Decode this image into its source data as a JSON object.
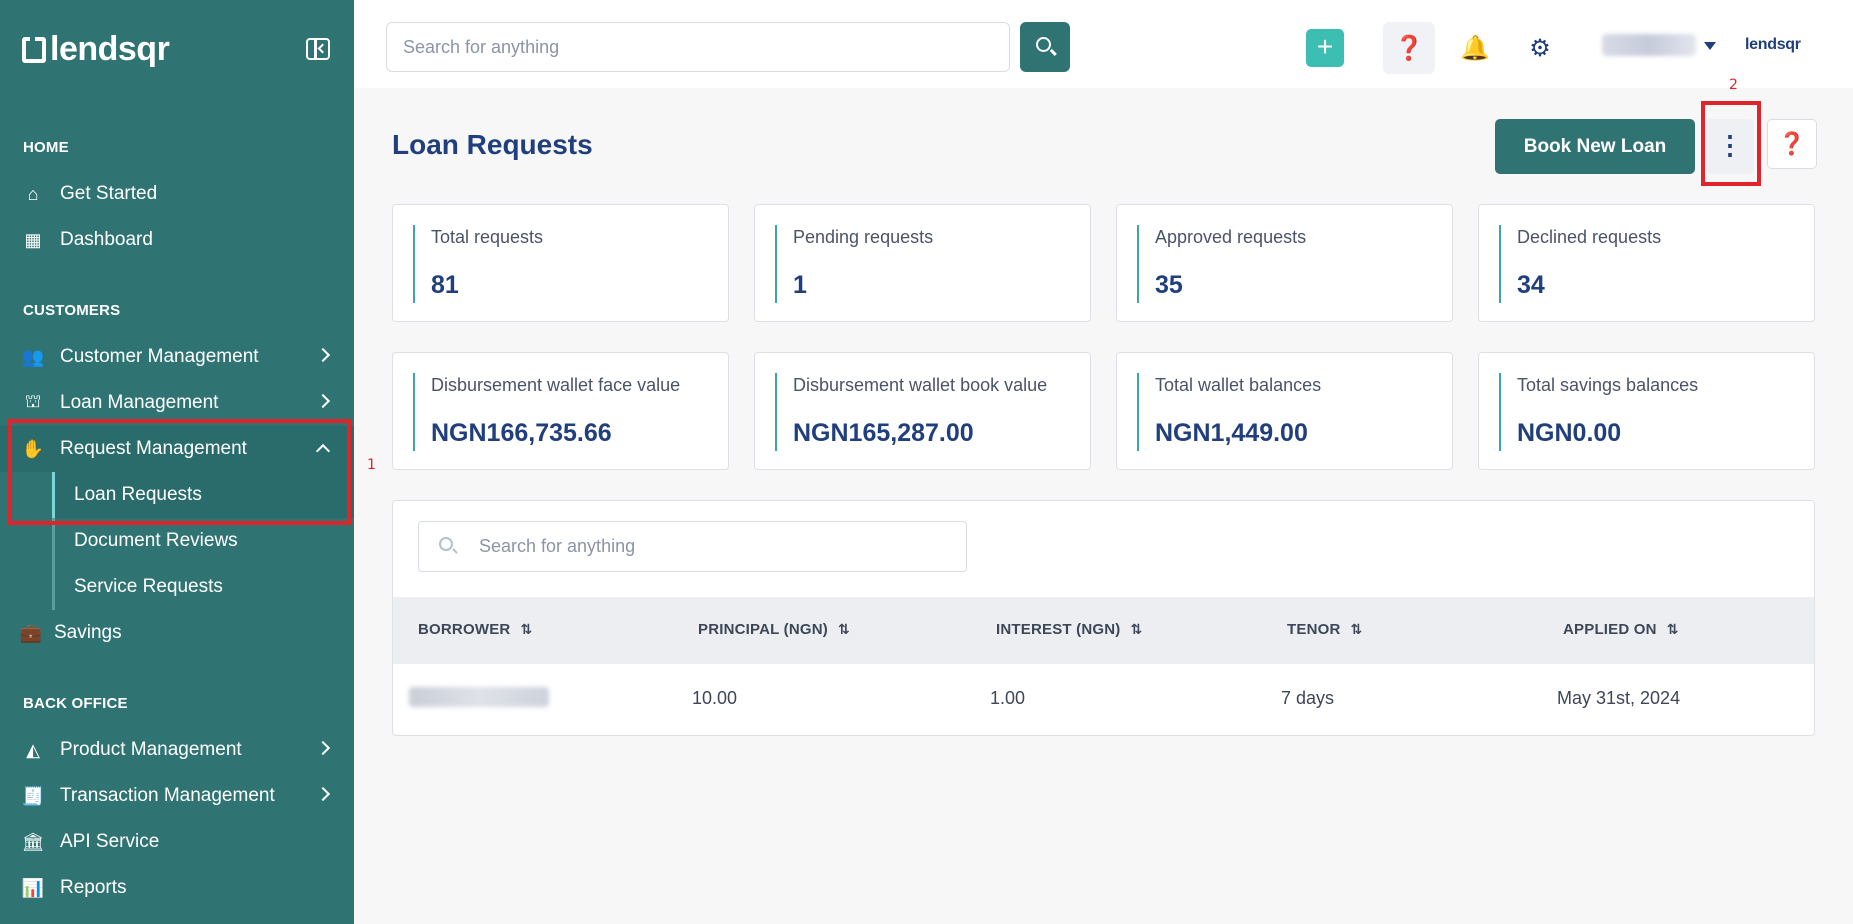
{
  "brand": {
    "logo_text": "lendsqr",
    "small_logo_text": "lendsqr"
  },
  "topbar": {
    "search_placeholder": "Search for anything"
  },
  "sidebar": {
    "sections": {
      "home": "HOME",
      "customers": "CUSTOMERS",
      "back_office": "BACK OFFICE"
    },
    "items": {
      "get_started": "Get Started",
      "dashboard": "Dashboard",
      "customer_management": "Customer Management",
      "loan_management": "Loan Management",
      "request_management": "Request Management",
      "loan_requests": "Loan Requests",
      "document_reviews": "Document Reviews",
      "service_requests": "Service Requests",
      "savings": "Savings",
      "product_management": "Product Management",
      "transaction_management": "Transaction Management",
      "api_service": "API Service",
      "reports": "Reports"
    }
  },
  "annotations": {
    "marker_1": "1",
    "marker_2": "2"
  },
  "page": {
    "title": "Loan Requests",
    "book_button": "Book New Loan",
    "more_glyph": "⋮"
  },
  "stats": [
    {
      "label": "Total requests",
      "value": "81"
    },
    {
      "label": "Pending requests",
      "value": "1"
    },
    {
      "label": "Approved requests",
      "value": "35"
    },
    {
      "label": "Declined requests",
      "value": "34"
    },
    {
      "label": "Disbursement wallet face value",
      "value": "NGN166,735.66"
    },
    {
      "label": "Disbursement wallet book value",
      "value": "NGN165,287.00"
    },
    {
      "label": "Total wallet balances",
      "value": "NGN1,449.00"
    },
    {
      "label": "Total savings balances",
      "value": "NGN0.00"
    }
  ],
  "table": {
    "search_placeholder": "Search for anything",
    "columns": [
      "BORROWER",
      "PRINCIPAL (NGN)",
      "INTEREST (NGN)",
      "TENOR",
      "APPLIED ON"
    ],
    "rows": [
      {
        "principal": "10.00",
        "interest": "1.00",
        "tenor": "7 days",
        "applied_on": "May 31st, 2024"
      }
    ]
  },
  "colors": {
    "sidebar": "#2f7373",
    "accent": "#3cbfb2",
    "navy": "#213f7d",
    "highlight": "#e0242c"
  }
}
